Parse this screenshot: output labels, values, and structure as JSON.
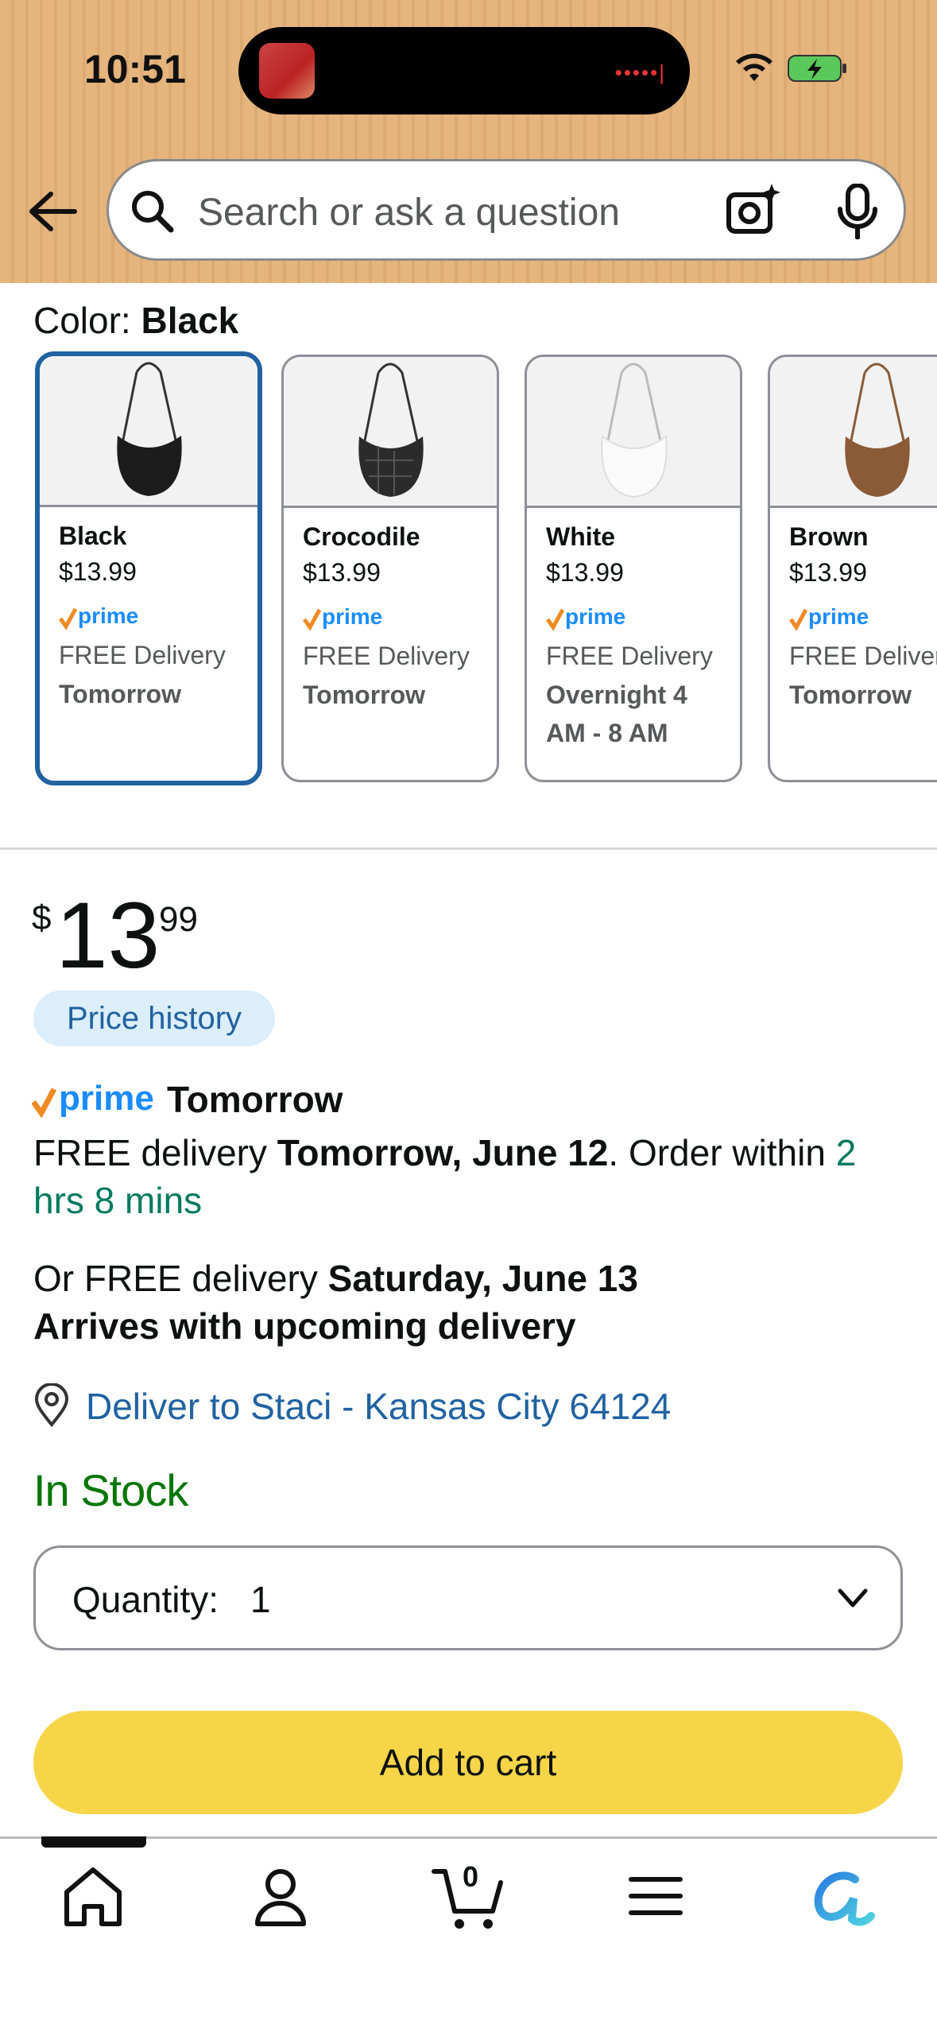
{
  "status_bar": {
    "time": "10:51"
  },
  "search": {
    "placeholder": "Search or ask a question"
  },
  "color_section": {
    "label": "Color: ",
    "selected": "Black",
    "swatches": [
      {
        "name": "Black",
        "price": "$13.99",
        "free": "FREE Delivery",
        "when": "Tomorrow",
        "selected": true
      },
      {
        "name": "Crocodile",
        "price": "$13.99",
        "free": "FREE Delivery",
        "when": "Tomorrow"
      },
      {
        "name": "White",
        "price": "$13.99",
        "free": "FREE Delivery",
        "when": "Overnight 4 AM - 8 AM"
      },
      {
        "name": "Brown",
        "price": "$13.99",
        "free": "FREE Deliver",
        "when": "Tomorrow"
      }
    ],
    "prime_text": "prime"
  },
  "price": {
    "symbol": "$",
    "whole": "13",
    "fraction": "99"
  },
  "price_history_label": "Price history",
  "prime_delivery": {
    "prime": "prime",
    "label": "Tomorrow"
  },
  "delivery": {
    "line1_prefix": "FREE delivery ",
    "line1_date": "Tomorrow, June 12",
    "line1_mid": ". Order within ",
    "line1_countdown": "2 hrs 8 mins",
    "line2_prefix": "Or FREE delivery ",
    "line2_date": "Saturday, June 13",
    "line2_note": "Arrives with upcoming delivery"
  },
  "deliver_to": "Deliver to Staci - Kansas City 64124",
  "stock": "In Stock",
  "quantity": {
    "label": "Quantity:",
    "value": "1"
  },
  "add_to_cart": "Add to cart",
  "cart_count": "0",
  "colors": {
    "accent_blue": "#2162a1",
    "cart_yellow": "#f7d548",
    "stock_green": "#007600",
    "countdown_green": "#007a5e"
  }
}
